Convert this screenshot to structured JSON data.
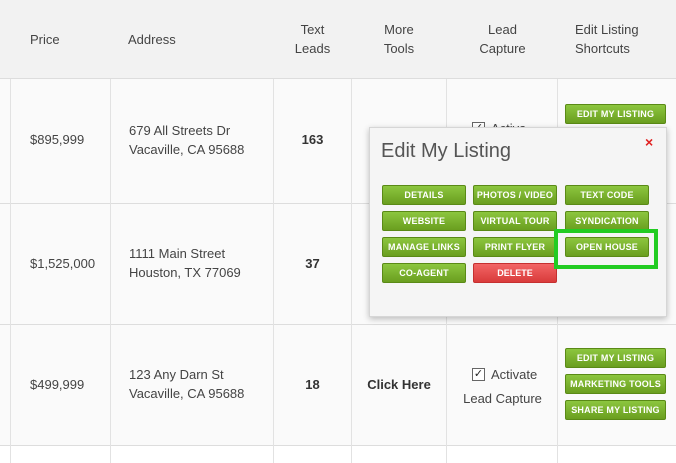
{
  "columns": {
    "price": "Price",
    "address": "Address",
    "text_leads": [
      "Text",
      "Leads"
    ],
    "more_tools": [
      "More",
      "Tools"
    ],
    "lead_capture": [
      "Lead",
      "Capture"
    ],
    "edit_shortcuts": [
      "Edit Listing",
      "Shortcuts"
    ]
  },
  "rows": [
    {
      "price": "$895,999",
      "address1": "679 All Streets Dr",
      "address2": "Vacaville, CA 95688",
      "leads": "163",
      "capture_partial": "Activa"
    },
    {
      "price": "$1,525,000",
      "address1": "1111 Main Street",
      "address2": "Houston, TX 77069",
      "leads": "37"
    },
    {
      "price": "$499,999",
      "address1": "123 Any Darn St",
      "address2": "Vacaville, CA 95688",
      "leads": "18",
      "more_tools": "Click Here",
      "activate": "Activate",
      "lead_capture": "Lead Capture"
    }
  ],
  "shortcuts": {
    "edit_my_listing": "EDIT MY LISTING",
    "marketing_tools": "MARKETING TOOLS",
    "share_my_listing": "SHARE MY LISTING"
  },
  "popup": {
    "title": "Edit My Listing",
    "close": "×",
    "buttons": {
      "details": "DETAILS",
      "photos_video": "PHOTOS / VIDEO",
      "text_code": "TEXT CODE",
      "website": "WEBSITE",
      "virtual_tour": "VIRTUAL TOUR",
      "syndication": "SYNDICATION",
      "manage_links": "MANAGE LINKS",
      "print_flyer": "PRINT FLYER",
      "open_house": "OPEN HOUSE",
      "co_agent": "CO-AGENT",
      "delete": "DELETE"
    }
  },
  "colors": {
    "accent_green": "#7ab32e",
    "delete_red": "#e04848",
    "highlight": "#22cc22"
  }
}
